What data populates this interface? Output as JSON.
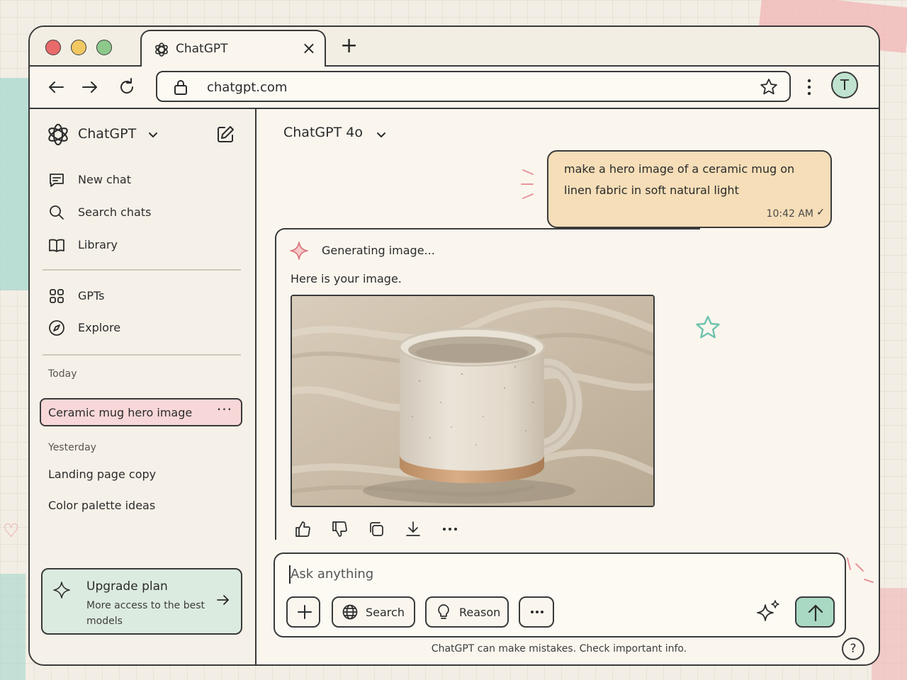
{
  "browser": {
    "tab_title": "ChatGPT",
    "url": "chatgpt.com",
    "avatar_initial": "T"
  },
  "sidebar": {
    "title": "ChatGPT",
    "nav": [
      {
        "label": "New chat",
        "icon": "new-chat-icon"
      },
      {
        "label": "Search chats",
        "icon": "search-icon"
      },
      {
        "label": "Library",
        "icon": "library-icon"
      },
      {
        "label": "GPTs",
        "icon": "grid-icon"
      },
      {
        "label": "Explore",
        "icon": "compass-icon"
      }
    ],
    "today_label": "Today",
    "today": [
      "Ceramic mug hero image"
    ],
    "yesterday_label": "Yesterday",
    "yesterday": [
      "Landing page copy",
      "Color palette ideas"
    ],
    "upgrade": {
      "title": "Upgrade plan",
      "subtitle": "More access to the best models"
    }
  },
  "main": {
    "model": "ChatGPT 4o",
    "user_message": {
      "text": "make a hero image of a ceramic mug on linen fabric in soft natural light",
      "time": "10:42 AM"
    },
    "assistant": {
      "status": "Generating image...",
      "text": "Here is your image."
    },
    "composer": {
      "placeholder": "Ask anything",
      "search_label": "Search",
      "reason_label": "Reason"
    },
    "footnote": "ChatGPT can make mistakes. Check important info.",
    "help": "?"
  },
  "colors": {
    "user_bubble": "#f5deb8",
    "active_chat": "#f7d7d7",
    "upgrade_card": "#dcebdf",
    "send_button": "#a9d9c3",
    "accent_pink": "#e8949a"
  }
}
